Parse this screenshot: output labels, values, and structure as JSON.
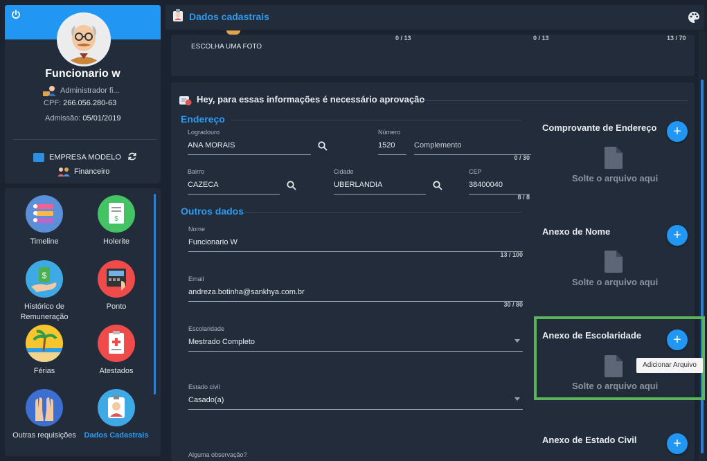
{
  "profile": {
    "name": "Funcionario w",
    "role": "Administrador fi...",
    "cpf_label": "CPF:",
    "cpf": "266.056.280-63",
    "admissao_label": "Admissão:",
    "admissao": "05/01/2019",
    "empresa": "EMPRESA MODELO",
    "departamento": "Financeiro",
    "accent": "#2196f3"
  },
  "menu": [
    {
      "label": "Timeline",
      "icon": "timeline-icon"
    },
    {
      "label": "Holerite",
      "icon": "holerite-icon"
    },
    {
      "label": "Histórico de Remuneração",
      "icon": "money-hand-icon"
    },
    {
      "label": "Ponto",
      "icon": "time-clock-icon"
    },
    {
      "label": "Férias",
      "icon": "beach-icon"
    },
    {
      "label": "Atestados",
      "icon": "medical-certificate-icon"
    },
    {
      "label": "Outras requisições",
      "icon": "raised-hands-icon"
    },
    {
      "label": "Dados Cadastrais",
      "icon": "id-badge-icon",
      "active": true
    }
  ],
  "header": {
    "title": "Dados cadastrais"
  },
  "top_card": {
    "photo_label": "ESCOLHA UMA FOTO",
    "counters": [
      "0 / 13",
      "0 / 13",
      "13 / 70"
    ]
  },
  "approval": {
    "text": "Hey, para essas informações é necessário aprovação"
  },
  "endereco": {
    "section": "Endereço",
    "logradouro_label": "Logradouro",
    "logradouro": "ANA MORAIS",
    "numero_label": "Número",
    "numero": "1520",
    "complemento_placeholder": "Complemento",
    "complemento_count": "0 / 30",
    "bairro_label": "Bairro",
    "bairro": "CAZECA",
    "cidade_label": "Cidade",
    "cidade": "UBERLANDIA",
    "cep_label": "CEP",
    "cep": "38400040",
    "cep_count": "8 / 8"
  },
  "outros": {
    "section": "Outros dados",
    "nome_label": "Nome",
    "nome": "Funcionario W",
    "nome_count": "13 / 100",
    "email_label": "Email",
    "email": "andreza.botinha@sankhya.com.br",
    "email_count": "30 / 80",
    "escolaridade_label": "Escolaridade",
    "escolaridade": "Mestrado Completo",
    "estado_civil_label": "Estado civil",
    "estado_civil": "Casado(a)",
    "observacao_label": "Alguma observação?"
  },
  "attachments": [
    {
      "title": "Comprovante de Endereço",
      "drop": "Solte o arquivo aqui"
    },
    {
      "title": "Anexo de Nome",
      "drop": "Solte o arquivo aqui"
    },
    {
      "title": "Anexo de Escolaridade",
      "drop": "Solte o arquivo aqui"
    },
    {
      "title": "Anexo de Estado Civil",
      "drop": ""
    }
  ],
  "tooltip": "Adicionar Arquivo",
  "colors": {
    "highlight": "#5ab45a",
    "link": "#2d9bf0",
    "panel": "#222c3a"
  }
}
